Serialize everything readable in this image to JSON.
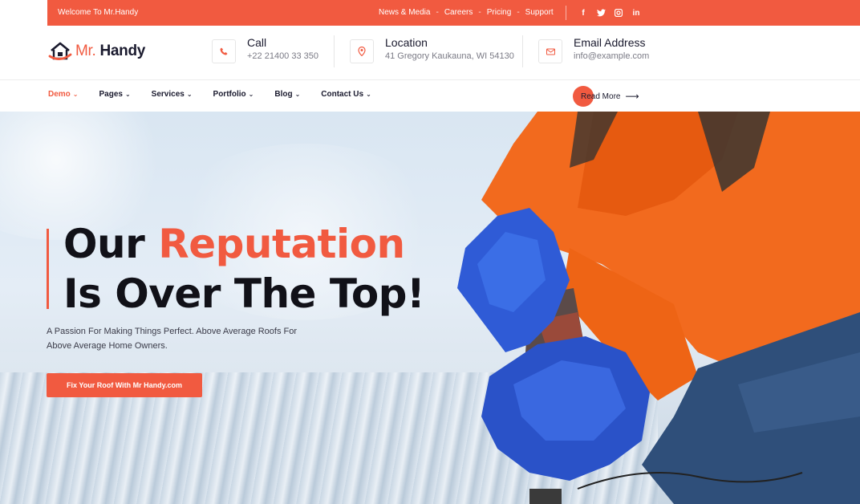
{
  "topbar": {
    "welcome": "Welcome To Mr.Handy",
    "links": [
      "News & Media",
      "Careers",
      "Pricing",
      "Support"
    ],
    "separator": "-",
    "socials": [
      "f",
      "t",
      "m",
      "in"
    ]
  },
  "header": {
    "logo": {
      "prefix": "Mr.",
      "name": "Handy"
    },
    "call": {
      "title": "Call",
      "value": "+22 21400 33 350"
    },
    "location": {
      "title": "Location",
      "value": "41 Gregory Kaukauna, WI 54130"
    },
    "email": {
      "title": "Email Address",
      "value": "info@example.com"
    }
  },
  "nav": {
    "items": [
      "Demo",
      "Pages",
      "Services",
      "Portfolio",
      "Blog",
      "Contact Us"
    ],
    "active": "Demo",
    "read_more": "Read More"
  },
  "hero": {
    "title_line1_plain": "Our",
    "title_line1_accent": "Reputation",
    "title_line2": "Is Over The Top!",
    "subtitle": "A Passion For Making Things Perfect. Above Average Roofs For Above Average Home Owners.",
    "cta": "Fix Your Roof With Mr Handy.com"
  },
  "colors": {
    "accent": "#f15a40",
    "dark": "#111118",
    "sky": "#dfe8f1"
  },
  "icons": [
    "phone-icon",
    "location-pin-icon",
    "envelope-icon",
    "facebook-icon",
    "twitter-icon",
    "instagram-icon",
    "linkedin-icon",
    "arrow-right-icon",
    "chevron-down-icon",
    "house-logo-icon"
  ]
}
